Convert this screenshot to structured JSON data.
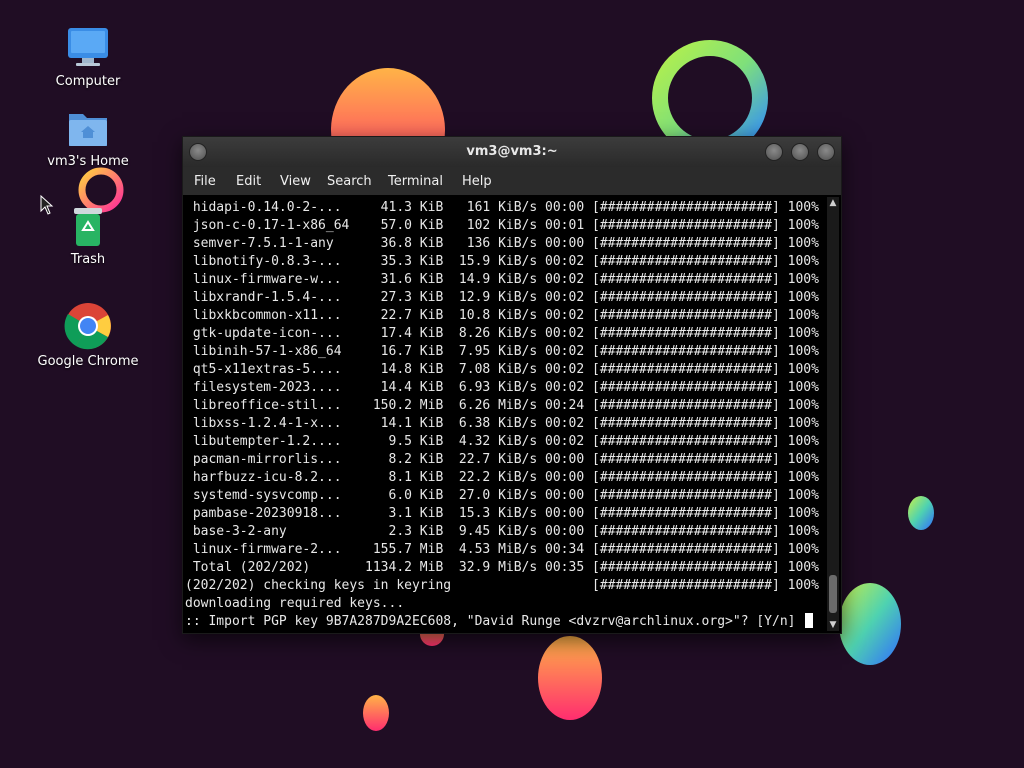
{
  "desktop": {
    "icons": [
      {
        "label": "Computer",
        "icon": "computer-icon"
      },
      {
        "label": "vm3's Home",
        "icon": "home-folder-icon"
      },
      {
        "label": "Trash",
        "icon": "trash-icon"
      },
      {
        "label": "Google Chrome",
        "icon": "chrome-icon"
      }
    ]
  },
  "window": {
    "title": "vm3@vm3:~",
    "menu": [
      "File",
      "Edit",
      "View",
      "Search",
      "Terminal",
      "Help"
    ]
  },
  "terminal": {
    "lines": [
      " hidapi-0.14.0-2-...     41.3 KiB   161 KiB/s 00:00 [######################] 100%",
      " json-c-0.17-1-x86_64    57.0 KiB   102 KiB/s 00:01 [######################] 100%",
      " semver-7.5.1-1-any      36.8 KiB   136 KiB/s 00:00 [######################] 100%",
      " libnotify-0.8.3-...     35.3 KiB  15.9 KiB/s 00:02 [######################] 100%",
      " linux-firmware-w...     31.6 KiB  14.9 KiB/s 00:02 [######################] 100%",
      " libxrandr-1.5.4-...     27.3 KiB  12.9 KiB/s 00:02 [######################] 100%",
      " libxkbcommon-x11...     22.7 KiB  10.8 KiB/s 00:02 [######################] 100%",
      " gtk-update-icon-...     17.4 KiB  8.26 KiB/s 00:02 [######################] 100%",
      " libinih-57-1-x86_64     16.7 KiB  7.95 KiB/s 00:02 [######################] 100%",
      " qt5-x11extras-5....     14.8 KiB  7.08 KiB/s 00:02 [######################] 100%",
      " filesystem-2023....     14.4 KiB  6.93 KiB/s 00:02 [######################] 100%",
      " libreoffice-stil...    150.2 MiB  6.26 MiB/s 00:24 [######################] 100%",
      " libxss-1.2.4-1-x...     14.1 KiB  6.38 KiB/s 00:02 [######################] 100%",
      " libutempter-1.2....      9.5 KiB  4.32 KiB/s 00:02 [######################] 100%",
      " pacman-mirrorlis...      8.2 KiB  22.7 KiB/s 00:00 [######################] 100%",
      " harfbuzz-icu-8.2...      8.1 KiB  22.2 KiB/s 00:00 [######################] 100%",
      " systemd-sysvcomp...      6.0 KiB  27.0 KiB/s 00:00 [######################] 100%",
      " pambase-20230918...      3.1 KiB  15.3 KiB/s 00:00 [######################] 100%",
      " base-3-2-any             2.3 KiB  9.45 KiB/s 00:00 [######################] 100%",
      " linux-firmware-2...    155.7 MiB  4.53 MiB/s 00:34 [######################] 100%",
      " Total (202/202)       1134.2 MiB  32.9 MiB/s 00:35 [######################] 100%",
      "(202/202) checking keys in keyring                  [######################] 100%",
      "downloading required keys...",
      ":: Import PGP key 9B7A287D9A2EC608, \"David Runge <dvzrv@archlinux.org>\"? [Y/n] "
    ]
  }
}
